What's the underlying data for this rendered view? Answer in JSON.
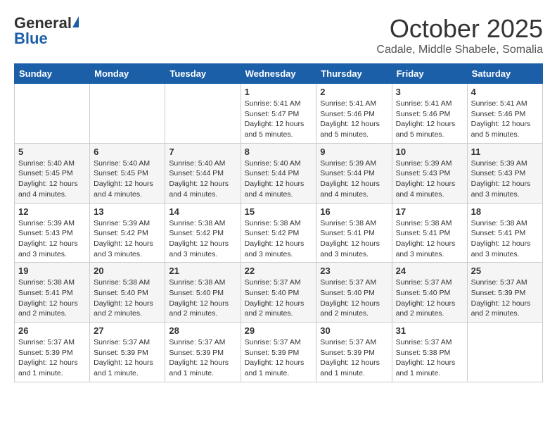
{
  "header": {
    "logo_general": "General",
    "logo_blue": "Blue",
    "month": "October 2025",
    "location": "Cadale, Middle Shabele, Somalia"
  },
  "weekdays": [
    "Sunday",
    "Monday",
    "Tuesday",
    "Wednesday",
    "Thursday",
    "Friday",
    "Saturday"
  ],
  "weeks": [
    [
      {
        "day": "",
        "info": ""
      },
      {
        "day": "",
        "info": ""
      },
      {
        "day": "",
        "info": ""
      },
      {
        "day": "1",
        "info": "Sunrise: 5:41 AM\nSunset: 5:47 PM\nDaylight: 12 hours\nand 5 minutes."
      },
      {
        "day": "2",
        "info": "Sunrise: 5:41 AM\nSunset: 5:46 PM\nDaylight: 12 hours\nand 5 minutes."
      },
      {
        "day": "3",
        "info": "Sunrise: 5:41 AM\nSunset: 5:46 PM\nDaylight: 12 hours\nand 5 minutes."
      },
      {
        "day": "4",
        "info": "Sunrise: 5:41 AM\nSunset: 5:46 PM\nDaylight: 12 hours\nand 5 minutes."
      }
    ],
    [
      {
        "day": "5",
        "info": "Sunrise: 5:40 AM\nSunset: 5:45 PM\nDaylight: 12 hours\nand 4 minutes."
      },
      {
        "day": "6",
        "info": "Sunrise: 5:40 AM\nSunset: 5:45 PM\nDaylight: 12 hours\nand 4 minutes."
      },
      {
        "day": "7",
        "info": "Sunrise: 5:40 AM\nSunset: 5:44 PM\nDaylight: 12 hours\nand 4 minutes."
      },
      {
        "day": "8",
        "info": "Sunrise: 5:40 AM\nSunset: 5:44 PM\nDaylight: 12 hours\nand 4 minutes."
      },
      {
        "day": "9",
        "info": "Sunrise: 5:39 AM\nSunset: 5:44 PM\nDaylight: 12 hours\nand 4 minutes."
      },
      {
        "day": "10",
        "info": "Sunrise: 5:39 AM\nSunset: 5:43 PM\nDaylight: 12 hours\nand 4 minutes."
      },
      {
        "day": "11",
        "info": "Sunrise: 5:39 AM\nSunset: 5:43 PM\nDaylight: 12 hours\nand 3 minutes."
      }
    ],
    [
      {
        "day": "12",
        "info": "Sunrise: 5:39 AM\nSunset: 5:43 PM\nDaylight: 12 hours\nand 3 minutes."
      },
      {
        "day": "13",
        "info": "Sunrise: 5:39 AM\nSunset: 5:42 PM\nDaylight: 12 hours\nand 3 minutes."
      },
      {
        "day": "14",
        "info": "Sunrise: 5:38 AM\nSunset: 5:42 PM\nDaylight: 12 hours\nand 3 minutes."
      },
      {
        "day": "15",
        "info": "Sunrise: 5:38 AM\nSunset: 5:42 PM\nDaylight: 12 hours\nand 3 minutes."
      },
      {
        "day": "16",
        "info": "Sunrise: 5:38 AM\nSunset: 5:41 PM\nDaylight: 12 hours\nand 3 minutes."
      },
      {
        "day": "17",
        "info": "Sunrise: 5:38 AM\nSunset: 5:41 PM\nDaylight: 12 hours\nand 3 minutes."
      },
      {
        "day": "18",
        "info": "Sunrise: 5:38 AM\nSunset: 5:41 PM\nDaylight: 12 hours\nand 3 minutes."
      }
    ],
    [
      {
        "day": "19",
        "info": "Sunrise: 5:38 AM\nSunset: 5:41 PM\nDaylight: 12 hours\nand 2 minutes."
      },
      {
        "day": "20",
        "info": "Sunrise: 5:38 AM\nSunset: 5:40 PM\nDaylight: 12 hours\nand 2 minutes."
      },
      {
        "day": "21",
        "info": "Sunrise: 5:38 AM\nSunset: 5:40 PM\nDaylight: 12 hours\nand 2 minutes."
      },
      {
        "day": "22",
        "info": "Sunrise: 5:37 AM\nSunset: 5:40 PM\nDaylight: 12 hours\nand 2 minutes."
      },
      {
        "day": "23",
        "info": "Sunrise: 5:37 AM\nSunset: 5:40 PM\nDaylight: 12 hours\nand 2 minutes."
      },
      {
        "day": "24",
        "info": "Sunrise: 5:37 AM\nSunset: 5:40 PM\nDaylight: 12 hours\nand 2 minutes."
      },
      {
        "day": "25",
        "info": "Sunrise: 5:37 AM\nSunset: 5:39 PM\nDaylight: 12 hours\nand 2 minutes."
      }
    ],
    [
      {
        "day": "26",
        "info": "Sunrise: 5:37 AM\nSunset: 5:39 PM\nDaylight: 12 hours\nand 1 minute."
      },
      {
        "day": "27",
        "info": "Sunrise: 5:37 AM\nSunset: 5:39 PM\nDaylight: 12 hours\nand 1 minute."
      },
      {
        "day": "28",
        "info": "Sunrise: 5:37 AM\nSunset: 5:39 PM\nDaylight: 12 hours\nand 1 minute."
      },
      {
        "day": "29",
        "info": "Sunrise: 5:37 AM\nSunset: 5:39 PM\nDaylight: 12 hours\nand 1 minute."
      },
      {
        "day": "30",
        "info": "Sunrise: 5:37 AM\nSunset: 5:39 PM\nDaylight: 12 hours\nand 1 minute."
      },
      {
        "day": "31",
        "info": "Sunrise: 5:37 AM\nSunset: 5:38 PM\nDaylight: 12 hours\nand 1 minute."
      },
      {
        "day": "",
        "info": ""
      }
    ]
  ]
}
